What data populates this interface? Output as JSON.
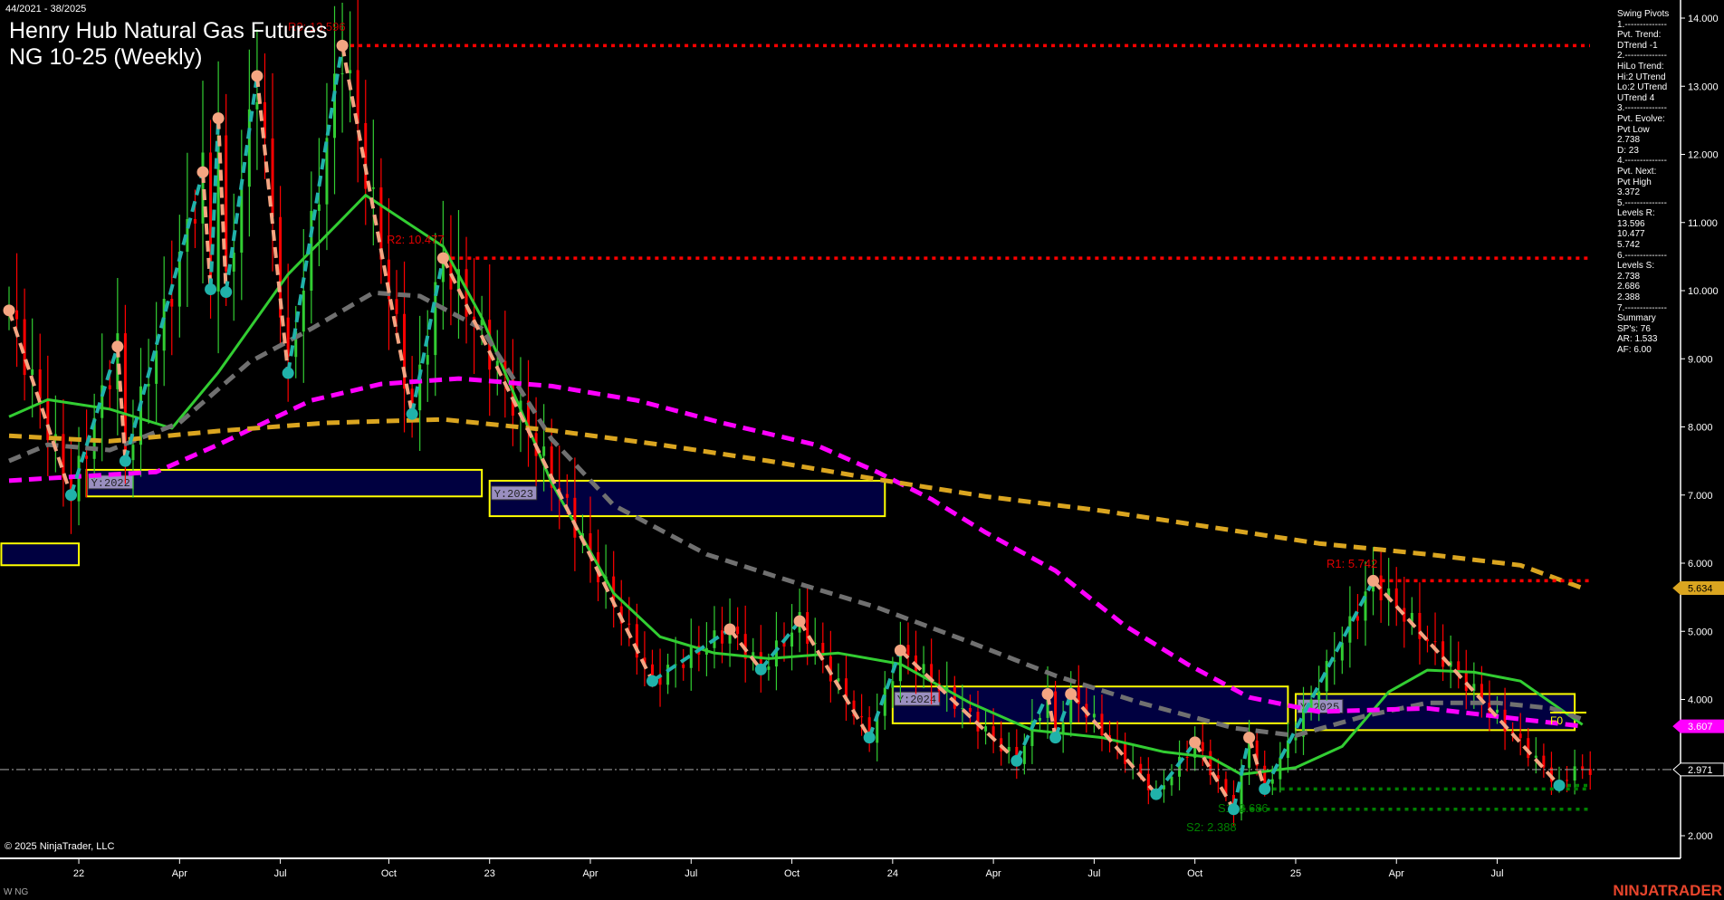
{
  "header": {
    "date_range": "44/2021 - 38/2025",
    "title_line1": "Henry Hub Natural Gas Futures",
    "title_line2": "NG 10-25 (Weekly)"
  },
  "footer": {
    "copyright": "© 2025 NinjaTrader, LLC",
    "symbol": "W NG",
    "brand": "NINJATRADER"
  },
  "panel": {
    "lines": [
      "Swing Pivots",
      "1.--------------",
      "Pvt. Trend:",
      "DTrend -1",
      "2.--------------",
      "HiLo Trend:",
      "Hi:2 UTrend",
      "Lo:2 UTrend",
      "UTrend 4",
      "3.--------------",
      "Pvt. Evolve:",
      "Pvt Low",
      "2.738",
      "D: 23",
      "4.--------------",
      "Pvt. Next:",
      "Pvt High",
      "3.372",
      "5.--------------",
      "Levels R:",
      "13.596",
      "10.477",
      "5.742",
      "6.--------------",
      "Levels S:",
      "2.738",
      "2.686",
      "2.388",
      "7.--------------",
      "Summary",
      "SP's: 76",
      "AR: 1.533",
      "AF: 6.00"
    ]
  },
  "colors": {
    "up_leg": "#20b2aa",
    "down_leg": "#f4a582",
    "fast_ma": "#32cd32",
    "mid_ma": "#707070",
    "slow_ma": "#ff00ff",
    "long_ma": "#daa520",
    "resistance": "#ff0000",
    "support": "#008000",
    "box": "#ffff00",
    "box_fill": "#000040",
    "bull": "#32cd32",
    "bear": "#ff0000"
  },
  "chart_data": {
    "type": "candlestick",
    "title": "Henry Hub Natural Gas Futures NG 10-25 (Weekly)",
    "x_unit": "week index from 44/2021",
    "y_ticks": [
      "2.000",
      "3.000",
      "4.000",
      "5.000",
      "6.000",
      "7.000",
      "8.000",
      "9.000",
      "10.000",
      "11.000",
      "12.000",
      "13.000",
      "14.000"
    ],
    "ylim": [
      1.6,
      14.2
    ],
    "x_ticks": [
      {
        "label": "22",
        "week": 9
      },
      {
        "label": "Apr",
        "week": 22
      },
      {
        "label": "Jul",
        "week": 35
      },
      {
        "label": "Oct",
        "week": 49
      },
      {
        "label": "23",
        "week": 62
      },
      {
        "label": "Apr",
        "week": 75
      },
      {
        "label": "Jul",
        "week": 88
      },
      {
        "label": "Oct",
        "week": 101
      },
      {
        "label": "24",
        "week": 114
      },
      {
        "label": "Apr",
        "week": 127
      },
      {
        "label": "Jul",
        "week": 140
      },
      {
        "label": "Oct",
        "week": 153
      },
      {
        "label": "25",
        "week": 166
      },
      {
        "label": "Apr",
        "week": 179
      },
      {
        "label": "Jul",
        "week": 192
      }
    ],
    "swing_pivots": [
      [
        0,
        9.71,
        "H"
      ],
      [
        8,
        7.0,
        "L"
      ],
      [
        14,
        9.18,
        "H"
      ],
      [
        15,
        7.5,
        "L"
      ],
      [
        25,
        11.74,
        "H"
      ],
      [
        26,
        10.02,
        "L"
      ],
      [
        27,
        12.53,
        "H"
      ],
      [
        28,
        9.98,
        "L"
      ],
      [
        32,
        13.15,
        "H"
      ],
      [
        36,
        8.79,
        "L"
      ],
      [
        43,
        13.596,
        "H"
      ],
      [
        52,
        8.19,
        "L"
      ],
      [
        56,
        10.477,
        "H"
      ],
      [
        83,
        4.27,
        "L"
      ],
      [
        93,
        5.03,
        "H"
      ],
      [
        97,
        4.44,
        "L"
      ],
      [
        102,
        5.15,
        "H"
      ],
      [
        111,
        3.44,
        "L"
      ],
      [
        115,
        4.72,
        "H"
      ],
      [
        130,
        3.1,
        "L"
      ],
      [
        134,
        4.08,
        "H"
      ],
      [
        135,
        3.44,
        "L"
      ],
      [
        137,
        4.08,
        "H"
      ],
      [
        148,
        2.61,
        "L"
      ],
      [
        153,
        3.37,
        "H"
      ],
      [
        158,
        2.388,
        "L"
      ],
      [
        160,
        3.44,
        "H"
      ],
      [
        162,
        2.686,
        "L"
      ],
      [
        176,
        5.742,
        "H"
      ],
      [
        200,
        2.738,
        "L"
      ]
    ],
    "last_weeks": [
      [
        201,
        2.85
      ],
      [
        202,
        3.05
      ],
      [
        203,
        2.9
      ],
      [
        204,
        2.971
      ]
    ],
    "moving_averages": [
      {
        "name": "fast",
        "color_key": "fast_ma",
        "dashed": false,
        "points": [
          [
            0,
            8.15
          ],
          [
            5,
            8.4
          ],
          [
            13,
            8.26
          ],
          [
            21,
            7.98
          ],
          [
            27,
            8.8
          ],
          [
            36,
            10.24
          ],
          [
            46,
            11.4
          ],
          [
            56,
            10.65
          ],
          [
            61,
            9.6
          ],
          [
            70,
            7.18
          ],
          [
            78,
            5.56
          ],
          [
            84,
            4.92
          ],
          [
            91,
            4.68
          ],
          [
            98,
            4.6
          ],
          [
            107,
            4.68
          ],
          [
            115,
            4.52
          ],
          [
            124,
            3.95
          ],
          [
            132,
            3.55
          ],
          [
            141,
            3.44
          ],
          [
            149,
            3.23
          ],
          [
            155,
            3.15
          ],
          [
            159,
            2.9
          ],
          [
            166,
            3.0
          ],
          [
            172,
            3.31
          ],
          [
            178,
            4.11
          ],
          [
            183,
            4.43
          ],
          [
            189,
            4.4
          ],
          [
            195,
            4.27
          ],
          [
            203,
            3.63
          ]
        ]
      },
      {
        "name": "mid",
        "color_key": "mid_ma",
        "dashed": true,
        "points": [
          [
            0,
            7.5
          ],
          [
            5,
            7.74
          ],
          [
            13,
            7.66
          ],
          [
            22,
            8.06
          ],
          [
            31,
            8.95
          ],
          [
            39,
            9.44
          ],
          [
            47,
            9.97
          ],
          [
            53,
            9.92
          ],
          [
            61,
            9.44
          ],
          [
            70,
            7.82
          ],
          [
            78,
            6.85
          ],
          [
            90,
            6.13
          ],
          [
            101,
            5.73
          ],
          [
            112,
            5.35
          ],
          [
            124,
            4.84
          ],
          [
            135,
            4.35
          ],
          [
            146,
            3.95
          ],
          [
            158,
            3.58
          ],
          [
            166,
            3.47
          ],
          [
            175,
            3.76
          ],
          [
            183,
            3.95
          ],
          [
            192,
            3.95
          ],
          [
            199,
            3.87
          ],
          [
            203,
            3.71
          ]
        ]
      },
      {
        "name": "slow",
        "color_key": "slow_ma",
        "dashed": true,
        "points": [
          [
            0,
            7.21
          ],
          [
            7,
            7.26
          ],
          [
            19,
            7.34
          ],
          [
            27,
            7.74
          ],
          [
            39,
            8.39
          ],
          [
            48,
            8.63
          ],
          [
            58,
            8.71
          ],
          [
            70,
            8.6
          ],
          [
            81,
            8.39
          ],
          [
            92,
            8.06
          ],
          [
            104,
            7.74
          ],
          [
            112,
            7.34
          ],
          [
            119,
            6.94
          ],
          [
            126,
            6.45
          ],
          [
            135,
            5.89
          ],
          [
            144,
            5.08
          ],
          [
            152,
            4.52
          ],
          [
            160,
            4.03
          ],
          [
            169,
            3.82
          ],
          [
            183,
            3.87
          ],
          [
            195,
            3.71
          ],
          [
            203,
            3.607
          ]
        ]
      },
      {
        "name": "long",
        "color_key": "long_ma",
        "dashed": true,
        "points": [
          [
            0,
            7.87
          ],
          [
            13,
            7.79
          ],
          [
            27,
            7.94
          ],
          [
            41,
            8.06
          ],
          [
            56,
            8.11
          ],
          [
            70,
            7.95
          ],
          [
            84,
            7.74
          ],
          [
            98,
            7.5
          ],
          [
            112,
            7.23
          ],
          [
            126,
            6.98
          ],
          [
            141,
            6.77
          ],
          [
            155,
            6.53
          ],
          [
            169,
            6.29
          ],
          [
            183,
            6.13
          ],
          [
            195,
            5.97
          ],
          [
            203,
            5.634
          ]
        ]
      }
    ],
    "levels": [
      {
        "label": "R3: 13.596",
        "price": 13.596,
        "from_week": 43,
        "type": "resistance"
      },
      {
        "label": "R2: 10.477",
        "price": 10.477,
        "from_week": 56,
        "type": "resistance"
      },
      {
        "label": "R1: 5.742",
        "price": 5.742,
        "from_week": 176,
        "type": "resistance"
      },
      {
        "label": "S1: 2.686",
        "price": 2.686,
        "from_week": 162,
        "type": "support"
      },
      {
        "label": "S2: 2.388",
        "price": 2.388,
        "from_week": 158,
        "type": "support"
      },
      {
        "label": "",
        "price": 2.738,
        "from_week": 200,
        "type": "support"
      }
    ],
    "reference_line": 2.971,
    "year_boxes": [
      {
        "label": "",
        "weeks": [
          -1,
          9
        ],
        "prices": [
          5.97,
          6.29
        ]
      },
      {
        "label": "Y:2022",
        "weeks": [
          10,
          61
        ],
        "prices": [
          6.98,
          7.37
        ]
      },
      {
        "label": "Y:2023",
        "weeks": [
          62,
          113
        ],
        "prices": [
          6.69,
          7.21
        ]
      },
      {
        "label": "Y:2024",
        "weeks": [
          114,
          165
        ],
        "prices": [
          3.65,
          4.19
        ]
      },
      {
        "label": "Y:2025",
        "weeks": [
          166,
          202
        ],
        "prices": [
          3.55,
          4.08
        ]
      }
    ],
    "f0_label": "F0",
    "price_tags": [
      {
        "label": "5.634",
        "price": 5.634,
        "bg": "#daa520",
        "fg": "#000"
      },
      {
        "label": "3.607",
        "price": 3.607,
        "bg": "#ff00ff",
        "fg": "#fff"
      },
      {
        "label": "2.971",
        "price": 2.971,
        "bg": "#000",
        "fg": "#fff"
      }
    ]
  }
}
